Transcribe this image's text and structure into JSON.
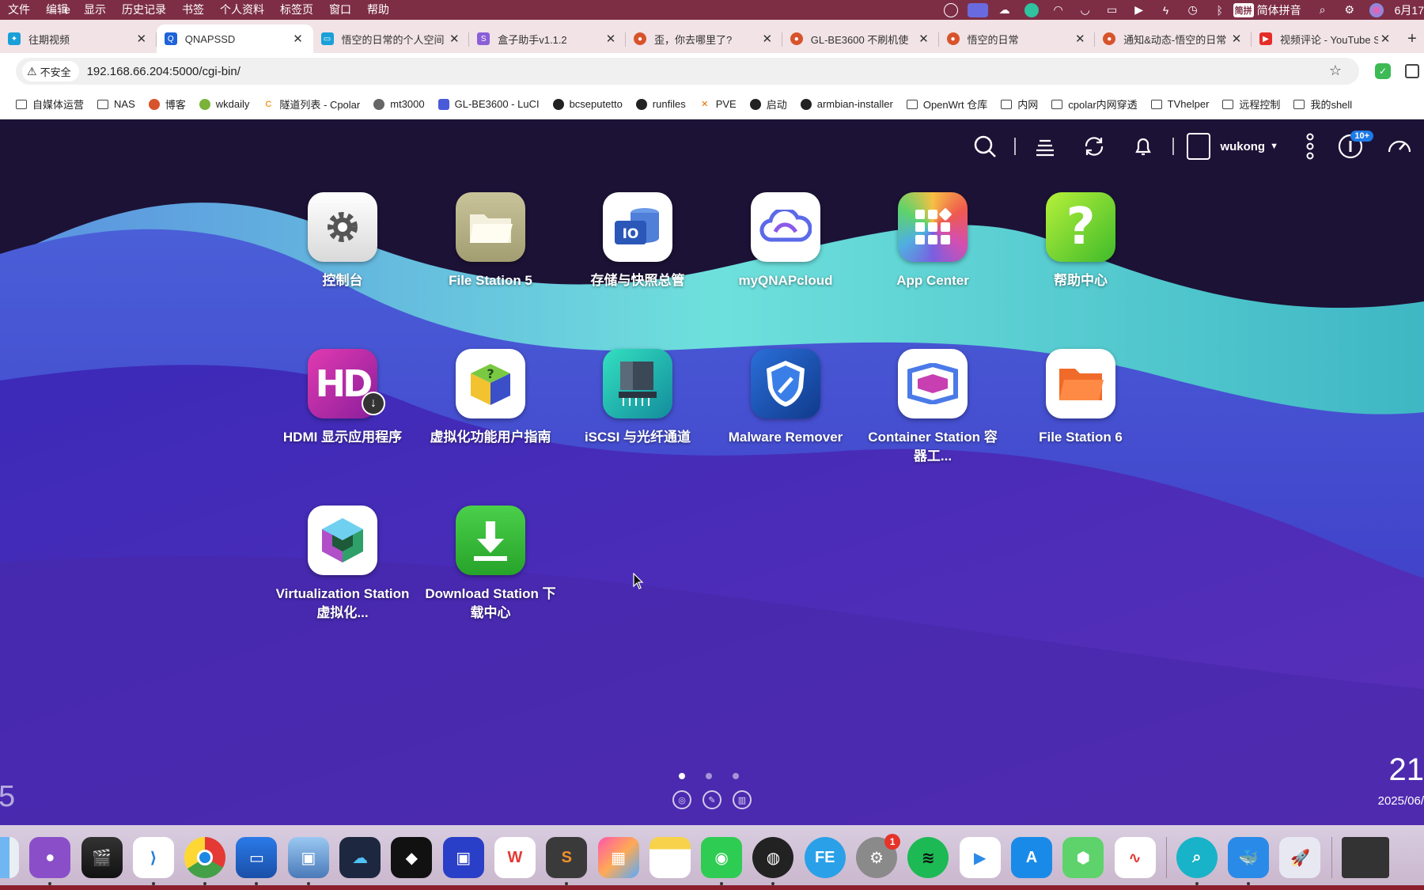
{
  "menubar": {
    "app_fragment": "e",
    "items": [
      "文件",
      "编辑",
      "显示",
      "历史记录",
      "书签",
      "个人资料",
      "标签页",
      "窗口",
      "帮助"
    ],
    "ime_badge": "简拼",
    "ime_label": "简体拼音",
    "date": "6月17"
  },
  "tabs": [
    {
      "title": "往期视频",
      "favicon_color": "#1aa0d8"
    },
    {
      "title": "QNAPSSD",
      "favicon_color": "#1e63d8",
      "active": true
    },
    {
      "title": "悟空的日常的个人空间",
      "favicon_color": "#1aa0d8"
    },
    {
      "title": "盒子助手v1.1.2",
      "favicon_color": "#8b5fd8"
    },
    {
      "title": "歪，你去哪里了?",
      "favicon_color": "#d8532b"
    },
    {
      "title": "GL-BE3600 不刷机使",
      "favicon_color": "#d8532b"
    },
    {
      "title": "悟空的日常",
      "favicon_color": "#d8532b"
    },
    {
      "title": "通知&动态-悟空的日常",
      "favicon_color": "#d8532b"
    },
    {
      "title": "视频评论 - YouTube S",
      "favicon_color": "#e52d27"
    }
  ],
  "address": {
    "security_label": "不安全",
    "url": "192.168.66.204:5000/cgi-bin/"
  },
  "bookmarks": [
    {
      "label": "自媒体运营",
      "icon": "folder-icon"
    },
    {
      "label": "NAS",
      "icon": "folder-icon"
    },
    {
      "label": "博客",
      "icon": "site-icon",
      "color": "#d8532b"
    },
    {
      "label": "wkdaily",
      "icon": "site-icon",
      "color": "#7bb33a"
    },
    {
      "label": "隧道列表 - Cpolar",
      "icon": "site-icon",
      "color": "#f0a030"
    },
    {
      "label": "mt3000",
      "icon": "globe-icon",
      "color": "#666666"
    },
    {
      "label": "GL-BE3600 - LuCI",
      "icon": "site-icon",
      "color": "#4b5bd8"
    },
    {
      "label": "bcseputetto",
      "icon": "github-icon",
      "color": "#222222"
    },
    {
      "label": "runfiles",
      "icon": "github-icon",
      "color": "#222222"
    },
    {
      "label": "PVE",
      "icon": "site-icon",
      "color": "#e57000"
    },
    {
      "label": "启动",
      "icon": "github-icon",
      "color": "#222222"
    },
    {
      "label": "armbian-installer",
      "icon": "github-icon",
      "color": "#222222"
    },
    {
      "label": "OpenWrt 仓库",
      "icon": "folder-icon"
    },
    {
      "label": "内网",
      "icon": "folder-icon"
    },
    {
      "label": "cpolar内网穿透",
      "icon": "folder-icon"
    },
    {
      "label": "TVhelper",
      "icon": "folder-icon"
    },
    {
      "label": "远程控制",
      "icon": "folder-icon"
    },
    {
      "label": "我的shell",
      "icon": "folder-icon"
    }
  ],
  "nas_toolbar": {
    "username": "wukong",
    "notification_badge": "10+"
  },
  "apps": [
    {
      "label": "控制台",
      "icon": "gear-icon"
    },
    {
      "label": "File Station 5",
      "icon": "folder-icon"
    },
    {
      "label": "存储与快照总管",
      "icon": "storage-icon"
    },
    {
      "label": "myQNAPcloud",
      "icon": "cloud-icon"
    },
    {
      "label": "App Center",
      "icon": "app-grid-icon"
    },
    {
      "label": "帮助中心",
      "icon": "help-icon"
    },
    {
      "label": "HDMI 显示应用程序",
      "icon": "hdmi-icon"
    },
    {
      "label": "虚拟化功能用户指南",
      "icon": "cube-guide-icon"
    },
    {
      "label": "iSCSI 与光纤通道",
      "icon": "server-icon"
    },
    {
      "label": "Malware Remover",
      "icon": "shield-icon"
    },
    {
      "label": "Container Station 容器工...",
      "icon": "container-icon"
    },
    {
      "label": "File Station 6",
      "icon": "folder-icon"
    },
    {
      "label": "Virtualization Station 虚拟化...",
      "icon": "gem-icon"
    },
    {
      "label": "Download Station 下载中心",
      "icon": "download-icon"
    }
  ],
  "desktop": {
    "page_count": 3,
    "current_page": 1,
    "clock_fragment": "21",
    "date_fragment": "2025/06/",
    "page_number_fragment": "5"
  },
  "dock": {
    "apps": [
      "finder",
      "github-desktop",
      "final-cut",
      "vscode",
      "chrome",
      "preview",
      "screen-sharing",
      "cloud-app",
      "unity",
      "moonlight",
      "wps",
      "sublime-text",
      "launchpad",
      "notes",
      "wechat",
      "obs",
      "fe-file-explorer",
      "system-settings",
      "spotify",
      "bilibili",
      "app-store",
      "3d-viewer",
      "freeform",
      "qsync",
      "docker",
      "rocket",
      "screen"
    ],
    "system_settings_badge": "1"
  },
  "colors": {
    "menubar": "#7d2e45",
    "tabstrip": "#f1e3e6",
    "desktop_purple": "#3d2fc4",
    "wave_teal": "#5ee8d8"
  }
}
